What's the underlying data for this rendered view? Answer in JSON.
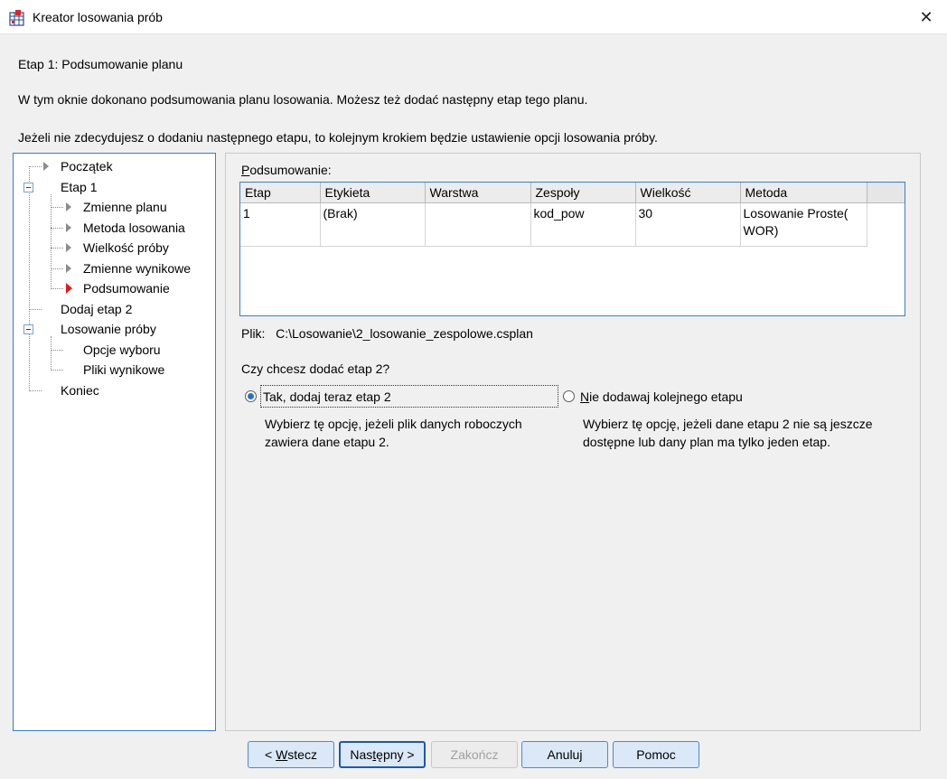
{
  "window": {
    "title": "Kreator losowania prób",
    "close_glyph": "✕"
  },
  "heading": "Etap 1: Podsumowanie planu",
  "intro": [
    "W tym oknie dokonano podsumowania planu losowania. Możesz też dodać następny etap tego planu.",
    "Jeżeli nie zdecydujesz o dodaniu następnego etapu, to kolejnym krokiem będzie ustawienie opcji losowania próby."
  ],
  "tree": {
    "items": [
      {
        "label": "Początek"
      },
      {
        "label": "Etap 1"
      },
      {
        "label": "Zmienne planu"
      },
      {
        "label": "Metoda losowania"
      },
      {
        "label": "Wielkość próby"
      },
      {
        "label": "Zmienne wynikowe"
      },
      {
        "label": "Podsumowanie"
      },
      {
        "label": "Dodaj etap 2"
      },
      {
        "label": "Losowanie próby"
      },
      {
        "label": "Opcje wyboru"
      },
      {
        "label": "Pliki wynikowe"
      },
      {
        "label": "Koniec"
      }
    ],
    "current": "Podsumowanie"
  },
  "summary": {
    "label_first": "P",
    "label_rest": "odsumowanie:",
    "columns": [
      "Etap",
      "Etykieta",
      "Warstwa",
      "Zespoły",
      "Wielkość",
      "Metoda"
    ],
    "rows": [
      [
        "1",
        "(Brak)",
        "",
        "kod_pow",
        "30",
        "Losowanie Proste(\nWOR)"
      ]
    ]
  },
  "file": {
    "label": "Plik:",
    "path": "C:\\Losowanie\\2_losowanie_zespolowe.csplan"
  },
  "question": "Czy chcesz dodać etap 2?",
  "options": [
    {
      "label": "Tak, dodaj teraz etap 2",
      "checked": true,
      "description": [
        "Wybierz tę opcję, jeżeli plik danych roboczych",
        "zawiera dane etapu 2."
      ]
    },
    {
      "label_first": "N",
      "label_rest": "ie dodawaj kolejnego etapu",
      "checked": false,
      "description": [
        "Wybierz tę opcję, jeżeli dane etapu 2 nie są jeszcze",
        "dostępne lub dany plan ma tylko jeden etap."
      ]
    }
  ],
  "buttons": {
    "back_prefix": "< ",
    "back_first": "W",
    "back_rest": "stecz",
    "next_pre": "Nas",
    "next_under": "t",
    "next_post": "ępny >",
    "finish": "Zakończ",
    "cancel": "Anuluj",
    "help": "Pomoc"
  },
  "colors": {
    "accent_border": "#3a7fc6",
    "button_bg": "#dbe8f7",
    "current_marker": "#e01b1b"
  }
}
